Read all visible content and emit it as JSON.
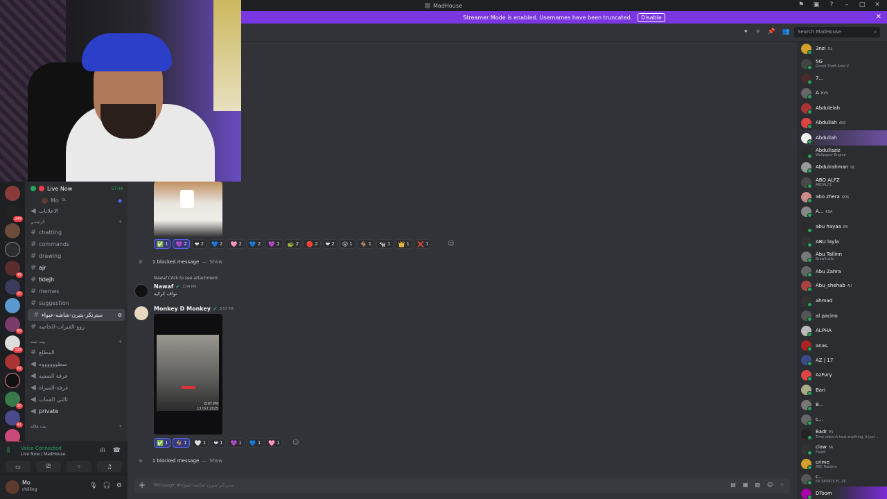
{
  "window": {
    "title": "MadHouse"
  },
  "streamer_bar": {
    "text": "Streamer Mode is enabled. Usernames have been truncated.",
    "disable_label": "Disable"
  },
  "search": {
    "placeholder": "Search MadHouse"
  },
  "voice_status": {
    "name": "Live Now",
    "time": "57:46",
    "member": "Mo",
    "member_tag": "OL"
  },
  "channels": {
    "c1": "الاعلانات",
    "cat1": "الرئيسي",
    "items": [
      "chatting",
      "commands",
      "drawing",
      "ajr",
      "tklejh",
      "memes",
      "suggestion",
      "سترنكر-يتيرن-شاشه-عبواء",
      "زوو-الفيرات-الخاصه"
    ],
    "cat2": "بيت نصه",
    "voice": [
      "المطلع",
      "صطووووووه",
      "غرفة الضفيه",
      "غرفة-الميراه",
      "ثالثي القماب",
      "private"
    ],
    "cat3": "بيت هلاله"
  },
  "voice_panel": {
    "title": "Voice Connected",
    "sub": "Live Now / MadHouse"
  },
  "user": {
    "name": "Mo",
    "status": "chilling"
  },
  "reactions_row1": [
    {
      "icon": "✅",
      "count": "1"
    },
    {
      "icon": "💜",
      "count": "2"
    },
    {
      "icon": "❤",
      "count": "2"
    },
    {
      "icon": "💙",
      "count": "2"
    },
    {
      "icon": "🩷",
      "count": "2"
    },
    {
      "icon": "💙",
      "count": "2"
    },
    {
      "icon": "💜",
      "count": "2"
    },
    {
      "icon": "🐢",
      "count": "2"
    },
    {
      "icon": "🔴",
      "count": "2"
    },
    {
      "icon": "❤",
      "count": "2"
    },
    {
      "icon": "😮",
      "count": "1"
    },
    {
      "icon": "🐐",
      "count": "1"
    },
    {
      "icon": "🐄",
      "count": "1"
    },
    {
      "icon": "👑",
      "count": "1"
    },
    {
      "icon": "❌",
      "count": "1"
    }
  ],
  "blocked": {
    "text": "1 blocked message",
    "sep": "—",
    "show": "Show"
  },
  "nawaf": {
    "reply": "Nawaf Click to see attachment",
    "name": "Nawaf",
    "time": "3:54 PM",
    "text": "نواف كركيه"
  },
  "monkey": {
    "name": "Monkey D Monkey",
    "time": "3:57 PM",
    "img_time": "8:07 PM",
    "img_date": "13 Oct 2025"
  },
  "reactions_row2": [
    {
      "icon": "✅",
      "count": "1"
    },
    {
      "icon": "🐐",
      "count": "1"
    },
    {
      "icon": "🤍",
      "count": "1"
    },
    {
      "icon": "❤",
      "count": "1"
    },
    {
      "icon": "💜",
      "count": "1"
    },
    {
      "icon": "💙",
      "count": "1"
    },
    {
      "icon": "🩷",
      "count": "1"
    }
  ],
  "composer": {
    "placeholder": "Message #سترنكر-يتيرن-شاشه-عبواء"
  },
  "members": [
    {
      "name": "3nzi",
      "tag": "OL",
      "sub": ""
    },
    {
      "name": "5G",
      "tag": "",
      "sub": "Grand Theft Auto V"
    },
    {
      "name": "7...",
      "tag": "",
      "sub": ""
    },
    {
      "name": "A",
      "tag": "NVS",
      "sub": ""
    },
    {
      "name": "Abdulelah",
      "tag": "",
      "sub": ""
    },
    {
      "name": "Abdullah",
      "tag": "ARC",
      "sub": ""
    },
    {
      "name": "Abdullah",
      "tag": "",
      "sub": ""
    },
    {
      "name": "Abdullaziz",
      "tag": "",
      "sub": "Wallpaper Engine"
    },
    {
      "name": "Abdulrahman",
      "tag": "OL",
      "sub": ""
    },
    {
      "name": "ABO ALFZ",
      "tag": "",
      "sub": "ABOALFZ"
    },
    {
      "name": "abo zhera",
      "tag": "SOS",
      "sub": ""
    },
    {
      "name": "A...",
      "tag": "KSA",
      "sub": ""
    },
    {
      "name": "abu hayaa",
      "tag": "EB",
      "sub": ""
    },
    {
      "name": "ABU layla",
      "tag": "",
      "sub": ""
    },
    {
      "name": "Abu Tallinn",
      "tag": "",
      "sub": "Brawlhalla"
    },
    {
      "name": "Abu Zahra",
      "tag": "",
      "sub": ""
    },
    {
      "name": "Abu_shehab",
      "tag": "All",
      "sub": ""
    },
    {
      "name": "ahmad",
      "tag": "",
      "sub": ""
    },
    {
      "name": "al pacino",
      "tag": "",
      "sub": ""
    },
    {
      "name": "ALPHA",
      "tag": "",
      "sub": ""
    },
    {
      "name": "anas.",
      "tag": "",
      "sub": ""
    },
    {
      "name": "AZ | 17",
      "tag": "",
      "sub": ""
    },
    {
      "name": "AzFury",
      "tag": "",
      "sub": ""
    },
    {
      "name": "Bari",
      "tag": "",
      "sub": ""
    },
    {
      "name": "B...",
      "tag": "",
      "sub": ""
    },
    {
      "name": "c...",
      "tag": "",
      "sub": ""
    },
    {
      "name": "Badr",
      "tag": "P1",
      "sub": "Time doesn't heal anything, it just ..."
    },
    {
      "name": "claw",
      "tag": "56",
      "sub": "FiveM"
    },
    {
      "name": "crime",
      "tag": "",
      "sub": "ARC Raiders"
    },
    {
      "name": "c...",
      "tag": "",
      "sub": "EA SPORTS FC 26"
    },
    {
      "name": "DToom",
      "tag": "",
      "sub": ""
    }
  ]
}
